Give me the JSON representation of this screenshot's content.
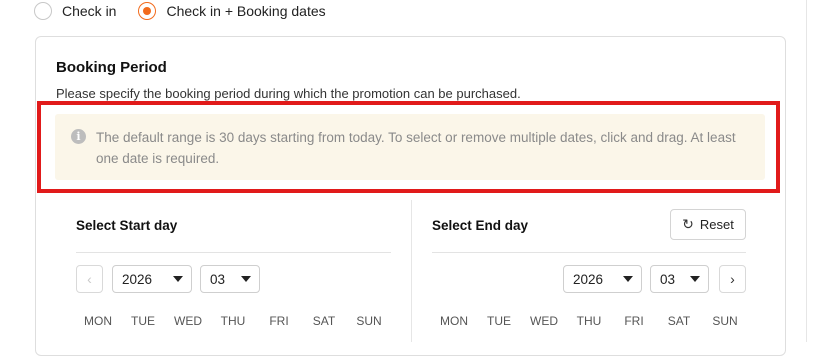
{
  "radio_options": [
    {
      "label": "Check in",
      "checked": false
    },
    {
      "label": "Check in + Booking dates",
      "checked": true
    }
  ],
  "booking": {
    "title": "Booking Period",
    "subtitle": "Please specify the booking period during which the promotion can be purchased.",
    "notice": "The default range is 30 days starting from today. To select or remove multiple dates, click and drag. At least one date is required.",
    "notice_icon": "info-icon"
  },
  "start_panel": {
    "title": "Select Start day",
    "year": "2026",
    "month": "03",
    "prev_icon": "chevron-left-icon"
  },
  "end_panel": {
    "title": "Select End day",
    "reset_label": "Reset",
    "reset_icon": "refresh-icon",
    "year": "2026",
    "month": "03",
    "next_icon": "chevron-right-icon"
  },
  "weekdays": [
    "MON",
    "TUE",
    "WED",
    "THU",
    "FRI",
    "SAT",
    "SUN"
  ],
  "colors": {
    "accent": "#f26b1d",
    "highlight_border": "#e11a1a",
    "notice_bg": "#fbf6e9"
  }
}
